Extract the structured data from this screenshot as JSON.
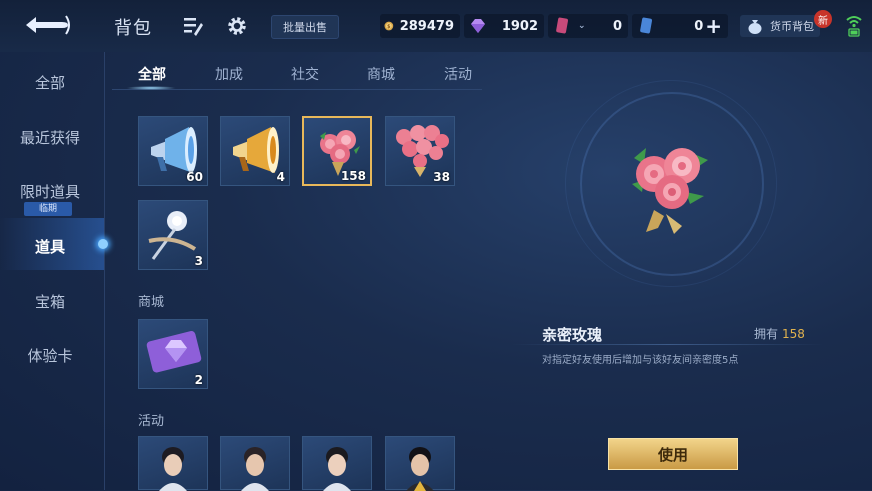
{
  "header": {
    "title": "背包",
    "batch_sell": "批量出售",
    "gold": "289479",
    "diamond": "1902",
    "card1": "0",
    "card2": "0",
    "wallet": "货币背包",
    "new_badge": "新"
  },
  "sidebar": {
    "items": [
      {
        "label": "全部"
      },
      {
        "label": "最近获得"
      },
      {
        "label": "限时道具"
      },
      {
        "label": "道具"
      },
      {
        "label": "宝箱"
      },
      {
        "label": "体验卡"
      }
    ],
    "limit_badge": "临期",
    "active": "道具"
  },
  "tabs": [
    {
      "label": "全部"
    },
    {
      "label": "加成"
    },
    {
      "label": "社交"
    },
    {
      "label": "商城"
    },
    {
      "label": "活动"
    }
  ],
  "items_social": [
    {
      "icon": "blue-megaphone-icon",
      "count": "60"
    },
    {
      "icon": "gold-megaphone-icon",
      "count": "4"
    },
    {
      "icon": "rose-bouquet-icon",
      "count": "158",
      "selected": true
    },
    {
      "icon": "rose-heart-bouquet-icon",
      "count": "38"
    },
    {
      "icon": "white-rose-icon",
      "count": "3"
    }
  ],
  "section_mall": "商城",
  "items_mall": [
    {
      "icon": "purple-diamond-ticket-icon",
      "count": "2"
    }
  ],
  "section_event": "活动",
  "detail": {
    "name": "亲密玫瑰",
    "own_label": "拥有",
    "own_count": "158",
    "description": "对指定好友使用后增加与该好友间亲密度5点",
    "use_button": "使用"
  },
  "colors": {
    "accent_gold": "#e0b24e",
    "selected_border": "#e8b85a",
    "bg": "#1a2c4d"
  }
}
